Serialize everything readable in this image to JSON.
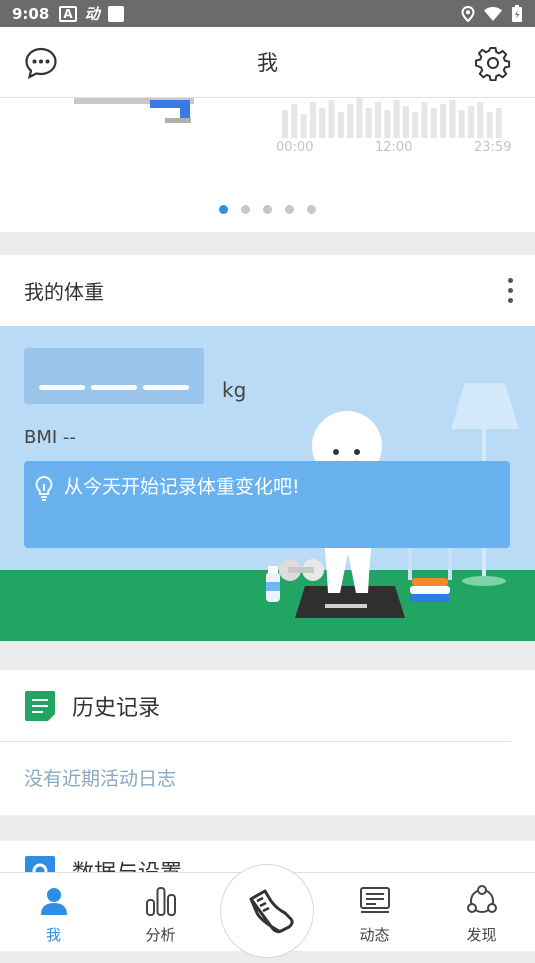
{
  "status_bar": {
    "time": "9:08",
    "icon_a": "A",
    "icon_b": "动"
  },
  "header": {
    "title": "我",
    "left_icon": "chat-bubble-icon",
    "right_icon": "gear-icon"
  },
  "carousel": {
    "axis_labels": [
      "00:00",
      "12:00",
      "23:59"
    ],
    "dot_count": 5,
    "active_dot": 0
  },
  "weight": {
    "title": "我的体重",
    "unit": "kg",
    "bmi_label": "BMI --",
    "tip": "从今天开始记录体重变化吧!"
  },
  "history": {
    "title": "历史记录",
    "empty_text": "没有近期活动日志"
  },
  "settings": {
    "title": "数据与设置"
  },
  "bottom_nav": {
    "items": [
      {
        "label": "我",
        "icon": "person-icon",
        "active": true
      },
      {
        "label": "分析",
        "icon": "bar-chart-icon",
        "active": false
      },
      {
        "label": "",
        "icon": "sneaker-icon",
        "active": false
      },
      {
        "label": "动态",
        "icon": "feed-icon",
        "active": false
      },
      {
        "label": "发现",
        "icon": "discover-icon",
        "active": false
      }
    ]
  },
  "colors": {
    "accent": "#2d8ee3",
    "grass": "#22a562",
    "sky": "#b9dbf6"
  }
}
